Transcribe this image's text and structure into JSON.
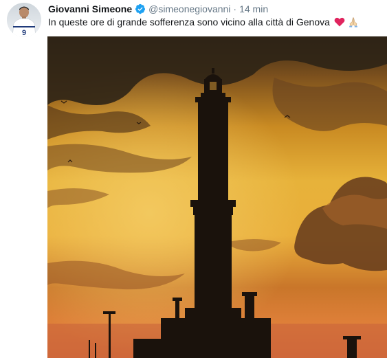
{
  "tweet": {
    "author_name": "Giovanni Simeone",
    "handle": "@simeonegiovanni",
    "separator": "·",
    "timestamp": "14 min",
    "text": "In queste ore di grande sofferenza sono vicino alla città di Genova",
    "emojis": [
      "red-heart-icon",
      "folded-hands-icon"
    ],
    "avatar_jersey_number": "9"
  },
  "colors": {
    "name": "#14171a",
    "secondary": "#657786",
    "verified": "#1da1f2",
    "heart": "#e0245e"
  },
  "icons": {
    "verified": "verified-badge-icon"
  }
}
